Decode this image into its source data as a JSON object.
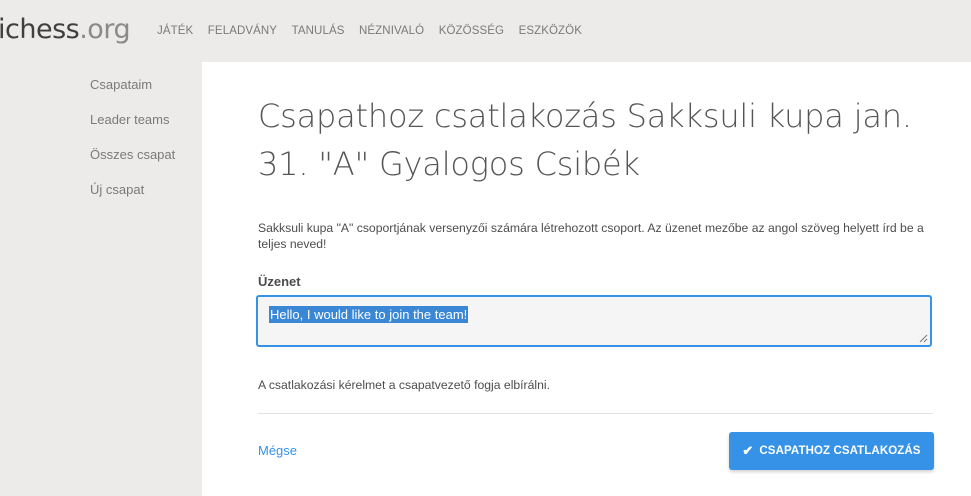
{
  "app": {
    "logo_main": "ichess",
    "logo_tld": ".org",
    "nav": [
      {
        "label": "JÁTÉK"
      },
      {
        "label": "FELADVÁNY"
      },
      {
        "label": "TANULÁS"
      },
      {
        "label": "NÉZNIVALÓ"
      },
      {
        "label": "KÖZÖSSÉG"
      },
      {
        "label": "ESZKÖZÖK"
      }
    ]
  },
  "sidebar": {
    "items": [
      {
        "label": "Csapataim"
      },
      {
        "label": "Leader teams"
      },
      {
        "label": "Összes csapat"
      },
      {
        "label": "Új csapat"
      }
    ]
  },
  "main": {
    "title": "Csapathoz csatlakozás Sakksuli kupa jan. 31. \"A\" Gyalogos Csibék",
    "description": "Sakksuli kupa \"A\" csoportjának versenyzői számára létrehozott csoport. Az üzenet mezőbe az angol szöveg helyett írd be a teljes neved!",
    "message_label": "Üzenet",
    "message_value": "Hello, I would like to join the team!",
    "note": "A csatlakozási kérelmet a csapatvezető fogja elbírálni.",
    "cancel_label": "Mégse",
    "submit_label": "CSAPATHOZ CSATLAKOZÁS",
    "submit_icon": "check-icon"
  },
  "colors": {
    "accent": "#3692e7",
    "page_bg": "#edebe9",
    "panel_bg": "#ffffff"
  }
}
